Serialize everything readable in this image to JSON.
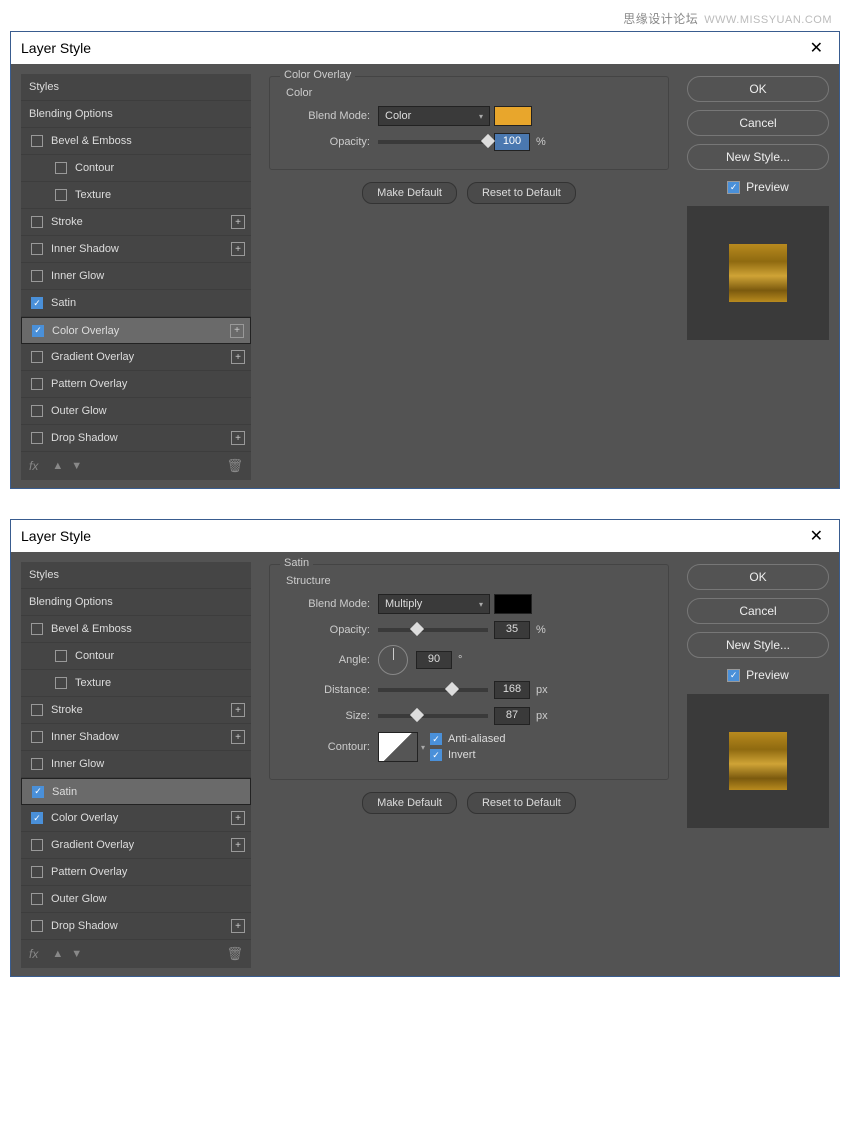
{
  "watermark": {
    "cn": "思缘设计论坛",
    "en": "WWW.MISSYUAN.COM"
  },
  "dialog_title": "Layer Style",
  "left": {
    "styles": "Styles",
    "blending": "Blending Options",
    "bevel": "Bevel & Emboss",
    "contour": "Contour",
    "texture": "Texture",
    "stroke": "Stroke",
    "inner_shadow": "Inner Shadow",
    "inner_glow": "Inner Glow",
    "satin": "Satin",
    "color_overlay": "Color Overlay",
    "gradient_overlay": "Gradient Overlay",
    "pattern_overlay": "Pattern Overlay",
    "outer_glow": "Outer Glow",
    "drop_shadow": "Drop Shadow",
    "fx": "fx"
  },
  "right": {
    "ok": "OK",
    "cancel": "Cancel",
    "new_style": "New Style...",
    "preview": "Preview"
  },
  "buttons": {
    "make_default": "Make Default",
    "reset_default": "Reset to Default"
  },
  "panel1": {
    "group": "Color Overlay",
    "sub": "Color",
    "blend_mode_lbl": "Blend Mode:",
    "blend_mode_val": "Color",
    "opacity_lbl": "Opacity:",
    "opacity_val": "100",
    "pct": "%",
    "swatch_color": "#e8a62c"
  },
  "panel2": {
    "group": "Satin",
    "sub": "Structure",
    "blend_mode_lbl": "Blend Mode:",
    "blend_mode_val": "Multiply",
    "swatch_color": "#000000",
    "opacity_lbl": "Opacity:",
    "opacity_val": "35",
    "pct": "%",
    "angle_lbl": "Angle:",
    "angle_val": "90",
    "deg": "°",
    "distance_lbl": "Distance:",
    "distance_val": "168",
    "px": "px",
    "size_lbl": "Size:",
    "size_val": "87",
    "contour_lbl": "Contour:",
    "anti": "Anti-aliased",
    "invert": "Invert"
  }
}
